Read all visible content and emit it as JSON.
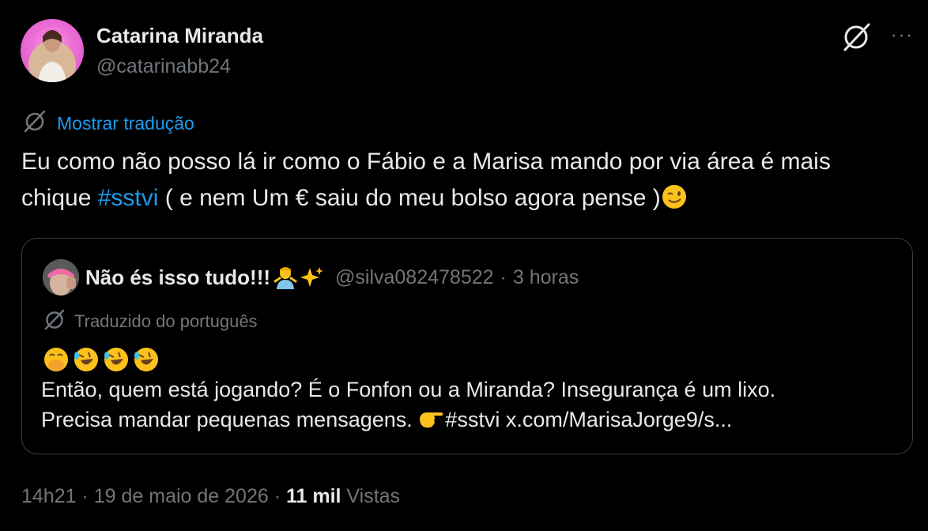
{
  "author": {
    "name": "Catarina Miranda",
    "handle": "@catarinabb24"
  },
  "header": {
    "translate_icon": "grok-slash-icon",
    "more_icon": "more-dots-icon",
    "more_label": "···"
  },
  "translation": {
    "link_label": "Mostrar tradução"
  },
  "tweet": {
    "text_before": "Eu como não posso lá ir como o Fábio e a Marisa mando por via área é mais chique ",
    "hashtag": "#sstvi",
    "text_after": " ( e nem Um € saiu do meu bolso agora pense )",
    "trailing_emoji": "winking-face-emoji"
  },
  "quote": {
    "name": "Não és isso tudo!!!",
    "name_emojis": [
      "person-shrugging-emoji",
      "sparkles-emoji"
    ],
    "handle": "@silva082478522",
    "separator": "·",
    "time": "3 horas",
    "translated_label": "Traduzido do português",
    "leading_emojis": [
      "face-with-hand-over-mouth-emoji",
      "rolling-on-floor-laughing-emoji",
      "rolling-on-floor-laughing-emoji",
      "rolling-on-floor-laughing-emoji"
    ],
    "line1": "Então, quem está jogando? É o Fonfon ou a Miranda? Insegurança é um lixo.",
    "line2_before": "Precisa mandar pequenas mensagens. ",
    "pointing_emoji": "backhand-index-pointing-right-emoji",
    "line2_hashtag": "#sstvi",
    "line2_link": " x.com/MarisaJorge9/s..."
  },
  "footer": {
    "time": "14h21",
    "sep1": " · ",
    "date": "19 de maio de 2026",
    "sep2": " · ",
    "views_count": "11 mil",
    "views_label": " Vistas"
  },
  "colors": {
    "background": "#000000",
    "text": "#e7e9ea",
    "secondary": "#71767b",
    "link": "#1d9bf0",
    "border": "#3a3f44"
  }
}
